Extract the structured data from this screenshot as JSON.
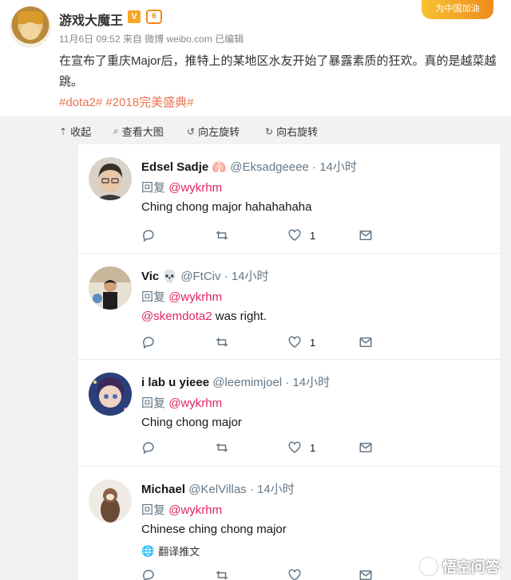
{
  "post": {
    "author": "游戏大魔王",
    "v_badge": "V",
    "level_badge": "6",
    "meta": "11月6日 09:52 来自 微博 weibo.com 已编辑",
    "text": "在宣布了重庆Major后，推特上的某地区水友开始了暴露素质的狂欢。真的是越菜越跳。",
    "tags": "#dota2# #2018完美盛典#",
    "corner_label": "为中国加油"
  },
  "toolbar": {
    "collapse": "收起",
    "view_large": "查看大图",
    "rotate_left": "向左旋转",
    "rotate_right": "向右旋转"
  },
  "tweets": [
    {
      "name": "Edsel Sadje",
      "emoji": "🫁",
      "handle": "@Eksadgeeee · 14小时",
      "reply_prefix": "回复",
      "reply_to": "@wykrhm",
      "body_mention": "",
      "body": "Ching chong major hahahahaha",
      "likes": "1"
    },
    {
      "name": "Vic",
      "emoji": "💀",
      "handle": "@FtCiv · 14小时",
      "reply_prefix": "回复",
      "reply_to": "@wykrhm",
      "body_mention": "@skemdota2",
      "body": " was right.",
      "likes": "1"
    },
    {
      "name": "i lab u yieee",
      "emoji": "",
      "handle": "@leemimjoel · 14小时",
      "reply_prefix": "回复",
      "reply_to": "@wykrhm",
      "body_mention": "",
      "body": "Ching chong major",
      "likes": "1"
    },
    {
      "name": "Michael",
      "emoji": "",
      "handle": "@KelVillas · 14小时",
      "reply_prefix": "回复",
      "reply_to": "@wykrhm",
      "body_mention": "",
      "body": "Chinese ching chong major",
      "translate": "翻译推文",
      "likes": ""
    }
  ],
  "watermark": "悟空问答",
  "colors": {
    "weibo_tag": "#eb7350",
    "twitter_mention": "#e0245e",
    "twitter_muted": "#657786"
  }
}
